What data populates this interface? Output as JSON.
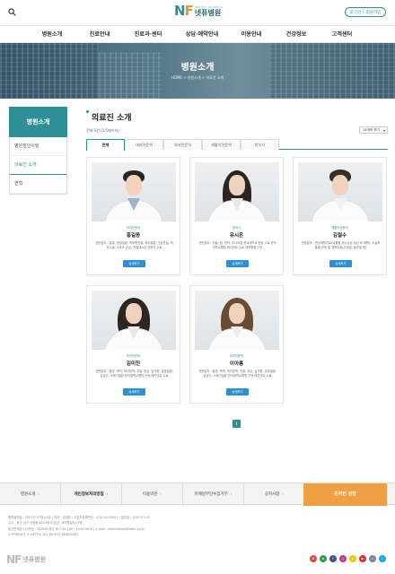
{
  "header": {
    "logo_mark_n": "N",
    "logo_mark_f": "F",
    "logo_sub": "NETHYU HOSPITAL",
    "logo_name": "넷퓨병원",
    "login": "로그인",
    "join": "회원가입"
  },
  "nav": [
    "병원소개",
    "진료안내",
    "진료과·센터",
    "상담·예약안내",
    "이용안내",
    "건강정보",
    "고객센터"
  ],
  "hero": {
    "title": "병원소개",
    "crumb": "HOME  >  병원소개  >  의료진 소개"
  },
  "sidebar": {
    "title": "병원소개",
    "items": [
      "병원장인사말",
      "의료진 소개",
      "연혁"
    ]
  },
  "main": {
    "title": "의료진 소개",
    "total": "전체 5건 (1/1페이지)",
    "sort": "15개씩 보기",
    "tabs": [
      "전체",
      "내과전문의",
      "외과전문의",
      "재활의전문의",
      "한의사"
    ],
    "detail_label": "상세보기",
    "page": "1"
  },
  "doctors": [
    {
      "dept": "외과전문의",
      "name": "홍길동",
      "desc": "전문분야 : 골절, 관절질환, 족부족관절, 척추질환, 인공관절, 척추수술, 스포츠 손상, 관절내시경 전문의 수료"
    },
    {
      "dept": "한의사",
      "name": "유시온",
      "desc": "전문분야 : 침술, 뜸, 한약, 추나요법 한국대학교 한방 수료 한국대학교병원 레지던트 수료 대학병원 근무"
    },
    {
      "dept": "재활의전문의",
      "name": "김철수",
      "desc": "전문분야 : 만성재활치료(뇌졸중,척수손상,외상 후 재활), 수술후 통증 관리 및 재활치료(고관절, 슬관절 등)"
    },
    {
      "dept": "외과전문의",
      "name": "김미진",
      "desc": "전문분야 : 탈장, 복막, 하지정맥, 치질, 담낭, 담석증, 유방질환, 갑상선, 소화기질환 한국대학교병원 인턴 레지던트 수료"
    },
    {
      "dept": "외과전문의",
      "name": "이아름",
      "desc": "전문분야 : 탈장, 복막, 하지정맥, 치질, 담낭, 담석증, 유방질환, 갑상선, 소화기질환 한국대학교병원 인턴 레지던트 수료"
    }
  ],
  "footer": {
    "links": [
      "병원소개",
      "개인정보처리방침",
      "이용약관",
      "이메일무단수집거부",
      "공지사항"
    ],
    "cta": "온라인 상담",
    "info": [
      "병원설립일 : 2007년 07월 02일 | 대표 : 김대표 | 사업자등록번호 : 405-14-00591 | 설립일 : 2007.07.02",
      "주소 : 광주 서구 치평동 1241번지(본관, 제이원빌딩) 9층",
      "통신판매업 신고번호 : 제2008-광주 동구-65 | Tel : 1544-9639 | e-mail : webmaster@netfu.co.kr",
      "COPYRIGHT © NETFU. ALL RIGHTS RESERVED."
    ],
    "logo_mark": "NF",
    "logo_text": "넷퓨병원"
  },
  "social": [
    {
      "icon": "blog-icon",
      "label": "B",
      "color": "#e04a3f"
    },
    {
      "icon": "band-icon",
      "label": "b",
      "color": "#2aa34a"
    },
    {
      "icon": "facebook-icon",
      "label": "f",
      "color": "#3b5998"
    },
    {
      "icon": "instagram-icon",
      "label": "◎",
      "color": "#c13584"
    },
    {
      "icon": "kakao-icon",
      "label": "k",
      "color": "#f3c400"
    },
    {
      "icon": "youtube-icon",
      "label": "▶",
      "color": "#e02f2f"
    },
    {
      "icon": "talk-icon",
      "label": "t",
      "color": "#7a8a9a"
    },
    {
      "icon": "twitter-icon",
      "label": "t",
      "color": "#1da1f2"
    }
  ]
}
